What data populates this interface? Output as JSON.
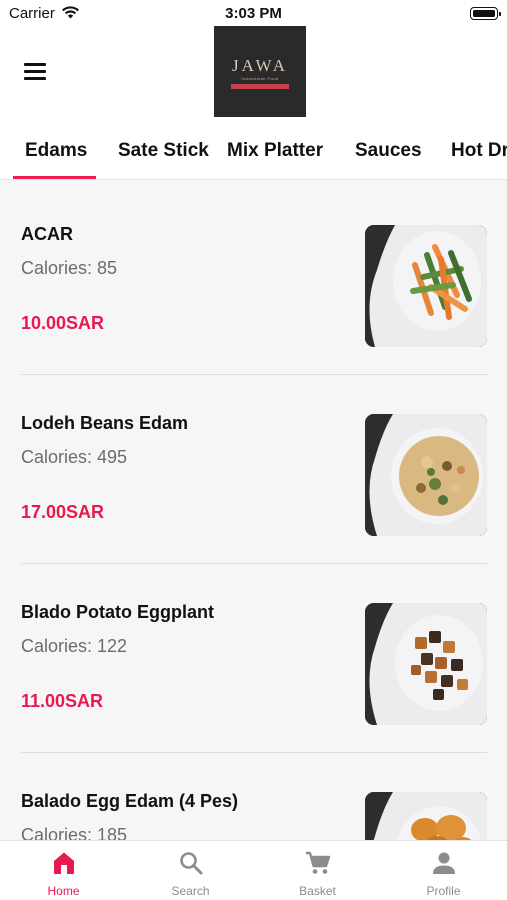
{
  "status_bar": {
    "carrier": "Carrier",
    "time": "3:03 PM"
  },
  "logo": {
    "wordmark": "JAWA",
    "tagline": "Indonesian Food"
  },
  "tabs": [
    {
      "label": "Edams"
    },
    {
      "label": "Sate Stick"
    },
    {
      "label": "Mix Platter"
    },
    {
      "label": "Sauces"
    },
    {
      "label": "Hot Dr"
    }
  ],
  "items": [
    {
      "name": "ACAR",
      "calories": "Calories: 85",
      "price": "10.00SAR"
    },
    {
      "name": "Lodeh Beans Edam",
      "calories": "Calories: 495",
      "price": "17.00SAR"
    },
    {
      "name": "Blado Potato Eggplant",
      "calories": "Calories: 122",
      "price": "11.00SAR"
    },
    {
      "name": "Balado Egg Edam (4 Pes)",
      "calories": "Calories: 185",
      "price": ""
    }
  ],
  "bottom_nav": [
    {
      "label": "Home",
      "icon": "home-icon"
    },
    {
      "label": "Search",
      "icon": "search-icon"
    },
    {
      "label": "Basket",
      "icon": "cart-icon"
    },
    {
      "label": "Profile",
      "icon": "person-icon"
    }
  ],
  "colors": {
    "accent": "#e81850",
    "inactive": "#8c8c8c"
  }
}
